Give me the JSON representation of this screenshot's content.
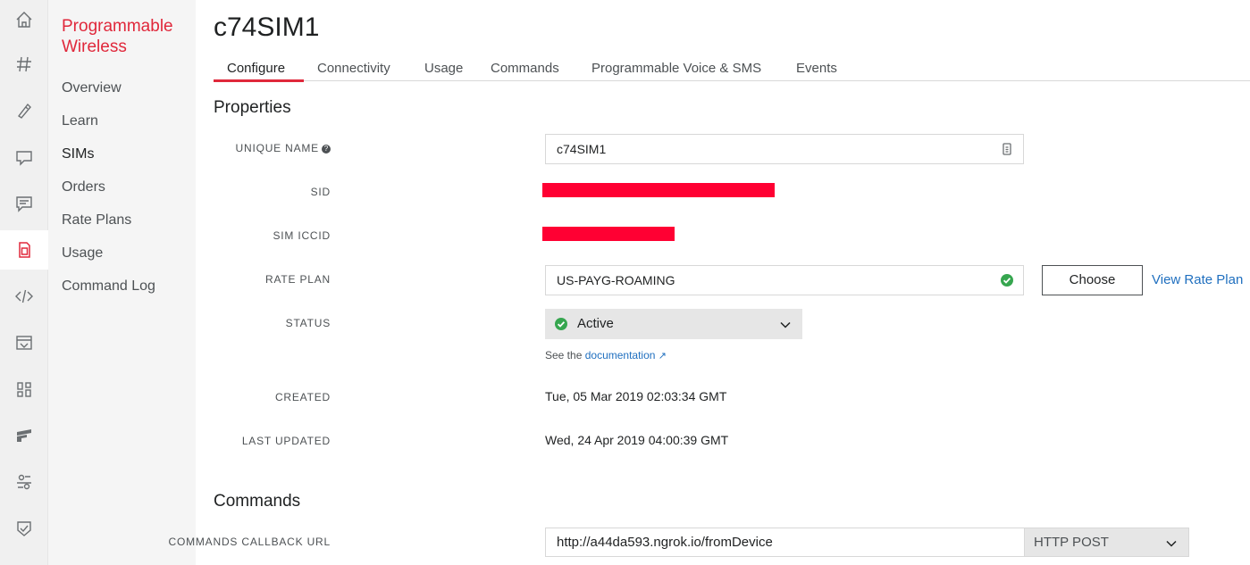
{
  "rail": {
    "icons": [
      "home-icon",
      "hash-icon",
      "phone-icon",
      "chat-bubble-icon",
      "messages-icon",
      "sim-card-icon",
      "code-icon",
      "studio-icon",
      "apps-icon",
      "flex-icon",
      "sync-icon",
      "verify-icon"
    ],
    "active": "sim-card-icon"
  },
  "nav": {
    "product_title": "Programmable Wireless",
    "items": [
      "Overview",
      "Learn",
      "SIMs",
      "Orders",
      "Rate Plans",
      "Usage",
      "Command Log"
    ],
    "active": "SIMs"
  },
  "page": {
    "title": "c74SIM1"
  },
  "tabs": [
    "Configure",
    "Connectivity",
    "Usage",
    "Commands",
    "Programmable Voice & SMS",
    "Events"
  ],
  "active_tab": "Configure",
  "properties": {
    "section_title": "Properties",
    "unique_name_label": "UNIQUE NAME",
    "unique_name_value": "c74SIM1",
    "sid_label": "SID",
    "iccid_label": "SIM ICCID",
    "rate_plan_label": "RATE PLAN",
    "rate_plan_value": "US-PAYG-ROAMING",
    "choose_label": "Choose",
    "view_rate_plan_label": "View Rate Plan",
    "status_label": "STATUS",
    "status_value": "Active",
    "hint_prefix": "See the",
    "hint_link": "documentation",
    "created_label": "CREATED",
    "created_value": "Tue, 05 Mar 2019 02:03:34 GMT",
    "updated_label": "LAST UPDATED",
    "updated_value": "Wed, 24 Apr 2019 04:00:39 GMT"
  },
  "commands": {
    "section_title": "Commands",
    "callback_label": "COMMANDS CALLBACK URL",
    "callback_value": "http://a44da593.ngrok.io/fromDevice",
    "method_value": "HTTP POST"
  },
  "colors": {
    "accent": "#e0283b",
    "link": "#1f6fbf",
    "redaction": "#ff0033",
    "success": "#36a64f"
  }
}
